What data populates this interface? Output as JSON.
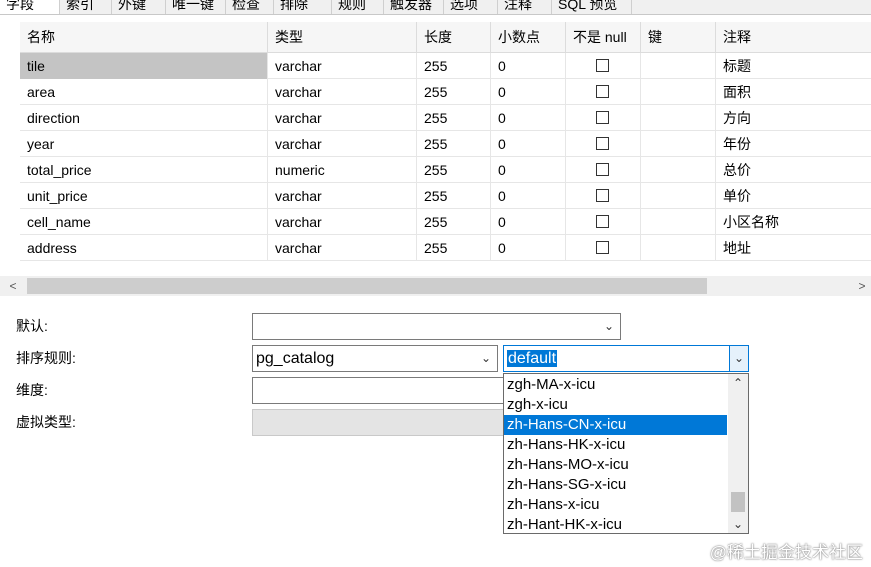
{
  "tabs": [
    "字段",
    "索引",
    "外键",
    "唯一键",
    "检查",
    "排除",
    "规则",
    "触发器",
    "选项",
    "注释",
    "SQL 预览"
  ],
  "columns_header": [
    "名称",
    "类型",
    "长度",
    "小数点",
    "不是 null",
    "键",
    "注释"
  ],
  "rows": [
    {
      "name": "tile",
      "type": "varchar",
      "length": "255",
      "decimal": "0",
      "comment": "标题"
    },
    {
      "name": "area",
      "type": "varchar",
      "length": "255",
      "decimal": "0",
      "comment": "面积"
    },
    {
      "name": "direction",
      "type": "varchar",
      "length": "255",
      "decimal": "0",
      "comment": "方向"
    },
    {
      "name": "year",
      "type": "varchar",
      "length": "255",
      "decimal": "0",
      "comment": "年份"
    },
    {
      "name": "total_price",
      "type": "numeric",
      "length": "255",
      "decimal": "0",
      "comment": "总价"
    },
    {
      "name": "unit_price",
      "type": "varchar",
      "length": "255",
      "decimal": "0",
      "comment": "单价"
    },
    {
      "name": "cell_name",
      "type": "varchar",
      "length": "255",
      "decimal": "0",
      "comment": "小区名称"
    },
    {
      "name": "address",
      "type": "varchar",
      "length": "255",
      "decimal": "0",
      "comment": "地址"
    }
  ],
  "props": {
    "default_label": "默认:",
    "default_value": "",
    "collation_label": "排序规则:",
    "collation_schema": "pg_catalog",
    "collation_value": "default",
    "dimension_label": "维度:",
    "dimension_value": "",
    "virtual_type_label": "虚拟类型:"
  },
  "dropdown_options": [
    "zgh-MA-x-icu",
    "zgh-x-icu",
    "zh-Hans-CN-x-icu",
    "zh-Hans-HK-x-icu",
    "zh-Hans-MO-x-icu",
    "zh-Hans-SG-x-icu",
    "zh-Hans-x-icu",
    "zh-Hant-HK-x-icu"
  ],
  "dropdown_highlighted_index": 2,
  "watermark": "@稀土掘金技术社区",
  "colors": {
    "accent": "#0078d7",
    "selected_row": "#c4c4c4"
  }
}
